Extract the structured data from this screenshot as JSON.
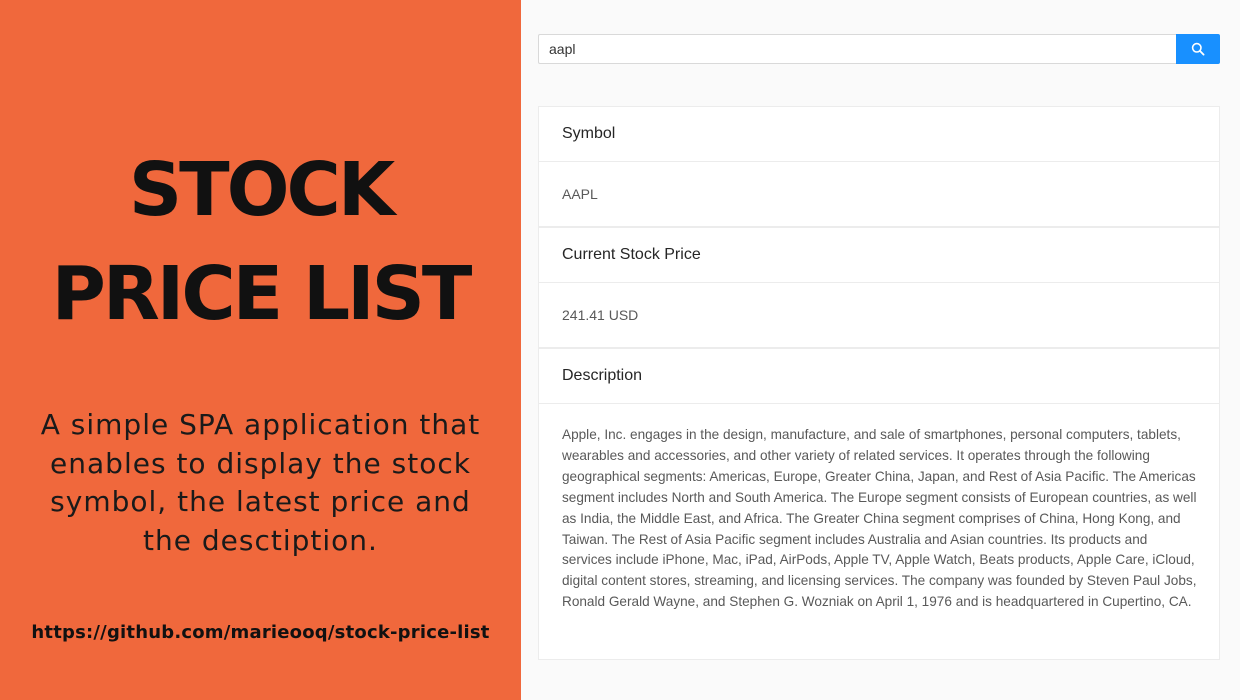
{
  "promo": {
    "title_line1": "STOCK",
    "title_line2": "PRICE LIST",
    "description": "A simple SPA application that enables to display the stock symbol, the latest price and the desctiption.",
    "link": "https://github.com/marieooq/stock-price-list"
  },
  "search": {
    "value": "aapl",
    "button_icon": "search-icon",
    "button_color": "#1890ff"
  },
  "sections": {
    "symbol": {
      "header": "Symbol",
      "value": "AAPL"
    },
    "price": {
      "header": "Current Stock Price",
      "value": "241.41 USD"
    },
    "description": {
      "header": "Description",
      "value": "Apple, Inc. engages in the design, manufacture, and sale of smartphones, personal computers, tablets, wearables and accessories, and other variety of related services. It operates through the following geographical segments: Americas, Europe, Greater China, Japan, and Rest of Asia Pacific. The Americas segment includes North and South America. The Europe segment consists of European countries, as well as India, the Middle East, and Africa. The Greater China segment comprises of China, Hong Kong, and Taiwan. The Rest of Asia Pacific segment includes Australia and Asian countries. Its products and services include iPhone, Mac, iPad, AirPods, Apple TV, Apple Watch, Beats products, Apple Care, iCloud, digital content stores, streaming, and licensing services. The company was founded by Steven Paul Jobs, Ronald Gerald Wayne, and Stephen G. Wozniak on April 1, 1976 and is headquartered in Cupertino, CA."
    }
  },
  "colors": {
    "promo_background": "#f0683c",
    "page_background": "#fafafa"
  }
}
